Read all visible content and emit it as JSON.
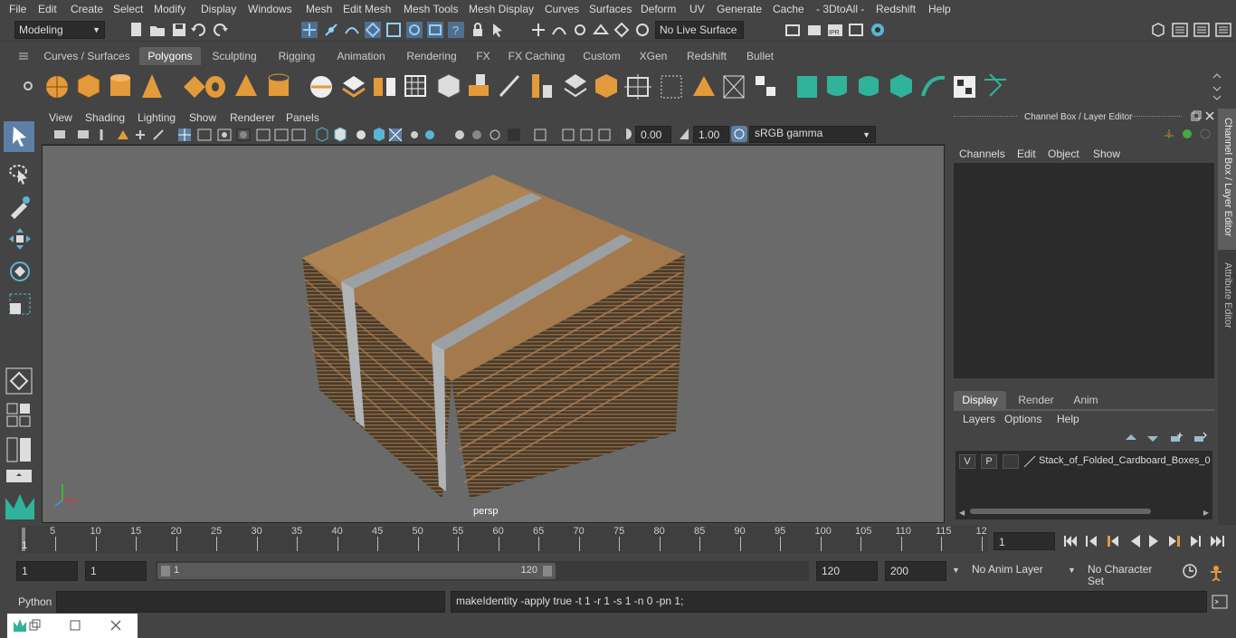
{
  "menubar": [
    "File",
    "Edit",
    "Create",
    "Select",
    "Modify",
    "Display",
    "Windows",
    "Mesh",
    "Edit Mesh",
    "Mesh Tools",
    "Mesh Display",
    "Curves",
    "Surfaces",
    "Deform",
    "UV",
    "Generate",
    "Cache",
    "- 3DtoAll -",
    "Redshift",
    "Help"
  ],
  "status": {
    "mode": "Modeling",
    "live_surface": "No Live Surface"
  },
  "shelf_tabs": [
    "Curves / Surfaces",
    "Polygons",
    "Sculpting",
    "Rigging",
    "Animation",
    "Rendering",
    "FX",
    "FX Caching",
    "Custom",
    "XGen",
    "Redshift",
    "Bullet"
  ],
  "shelf_active": "Polygons",
  "viewport": {
    "menus": [
      "View",
      "Shading",
      "Lighting",
      "Show",
      "Renderer",
      "Panels"
    ],
    "exposure": "0.00",
    "gamma": "1.00",
    "colorspace": "sRGB gamma",
    "camera_label": "persp"
  },
  "channel_box": {
    "title": "Channel Box / Layer Editor",
    "menus": [
      "Channels",
      "Edit",
      "Object",
      "Show"
    ],
    "tabs": [
      "Display",
      "Render",
      "Anim"
    ],
    "active_tab": "Display",
    "layer_menus": [
      "Layers",
      "Options",
      "Help"
    ],
    "layer": {
      "v": "V",
      "p": "P",
      "name": "Stack_of_Folded_Cardboard_Boxes_0"
    }
  },
  "side_tabs": [
    "Channel Box / Layer Editor",
    "Attribute Editor"
  ],
  "timeline": {
    "ticks": [
      "5",
      "10",
      "15",
      "20",
      "25",
      "30",
      "35",
      "40",
      "45",
      "50",
      "55",
      "60",
      "65",
      "70",
      "75",
      "80",
      "85",
      "90",
      "95",
      "100",
      "105",
      "110",
      "115",
      "12"
    ],
    "start_marker": "1",
    "current_frame": "1"
  },
  "range": {
    "start": "1",
    "playback_start": "1",
    "slider_start": "1",
    "slider_end": "120",
    "playback_end": "120",
    "end": "200",
    "anim_layer": "No Anim Layer",
    "character_set": "No Character Set"
  },
  "command": {
    "lang": "Python",
    "output": "makeIdentity -apply true -t 1 -r 1 -s 1 -n 0 -pn 1;"
  },
  "colors": {
    "accent": "#5d9ad3",
    "orange": "#e39a3a",
    "teal": "#2fb39a",
    "cardboard": "#a47a4c"
  }
}
